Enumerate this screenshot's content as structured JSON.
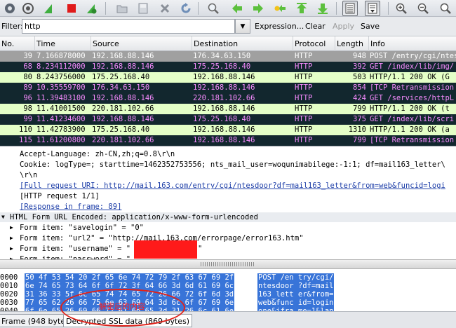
{
  "toolbar": {
    "icons": [
      "stop-capture-icon",
      "capture-options-icon",
      "shark-fin-icon",
      "stop-icon",
      "red-reload-icon",
      "open-icon",
      "save-icon",
      "close-icon",
      "reload-icon",
      "find-icon",
      "back-icon",
      "forward-icon",
      "go-to-icon",
      "first-icon",
      "last-icon",
      "colorize-icon",
      "autoscroll-icon",
      "zoom-in-icon",
      "zoom-out-icon",
      "zoom-reset-icon"
    ]
  },
  "filter": {
    "label": "Filter:",
    "value": "http",
    "expression": "Expression...",
    "clear": "Clear",
    "apply": "Apply",
    "save": "Save"
  },
  "packet_list": {
    "columns": [
      "No.",
      "Time",
      "Source",
      "Destination",
      "Protocol",
      "Length",
      "Info"
    ],
    "rows": [
      {
        "no": "39",
        "time": "7.166878000",
        "src": "192.168.88.146",
        "dst": "176.34.63.150",
        "proto": "HTTP",
        "len": "948",
        "info": "POST /entry/cgi/ntes",
        "bg": "#a0a0a0",
        "fg": "#ffffff"
      },
      {
        "no": "68",
        "time": "8.234112000",
        "src": "192.168.88.146",
        "dst": "175.25.168.40",
        "proto": "HTTP",
        "len": "392",
        "info": "GET /index/lib/img/",
        "bg": "#12272e",
        "fg": "#f78bff"
      },
      {
        "no": "80",
        "time": "8.243756000",
        "src": "175.25.168.40",
        "dst": "192.168.88.146",
        "proto": "HTTP",
        "len": "503",
        "info": "HTTP/1.1 200 OK  (G",
        "bg": "#e4ffc7",
        "fg": "#000000"
      },
      {
        "no": "89",
        "time": "10.35559700",
        "src": "176.34.63.150",
        "dst": "192.168.88.146",
        "proto": "HTTP",
        "len": "854",
        "info": "[TCP Retransmission",
        "bg": "#12272e",
        "fg": "#f78bff"
      },
      {
        "no": "96",
        "time": "11.39483100",
        "src": "192.168.88.146",
        "dst": "220.181.102.66",
        "proto": "HTTP",
        "len": "424",
        "info": "GET /services/httpL",
        "bg": "#12272e",
        "fg": "#f78bff"
      },
      {
        "no": "98",
        "time": "11.41001500",
        "src": "220.181.102.66",
        "dst": "192.168.88.146",
        "proto": "HTTP",
        "len": "799",
        "info": "HTTP/1.1 200 OK  (t",
        "bg": "#e4ffc7",
        "fg": "#000000"
      },
      {
        "no": "99",
        "time": "11.41234600",
        "src": "192.168.88.146",
        "dst": "175.25.168.40",
        "proto": "HTTP",
        "len": "375",
        "info": "GET /index/lib/scri",
        "bg": "#12272e",
        "fg": "#f78bff"
      },
      {
        "no": "110",
        "time": "11.42783900",
        "src": "175.25.168.40",
        "dst": "192.168.88.146",
        "proto": "HTTP",
        "len": "1310",
        "info": "HTTP/1.1 200 OK  (a",
        "bg": "#e4ffc7",
        "fg": "#000000"
      },
      {
        "no": "115",
        "time": "11.61200800",
        "src": "220.181.102.66",
        "dst": "192.168.88.146",
        "proto": "HTTP",
        "len": "799",
        "info": "[TCP Retransmission",
        "bg": "#12272e",
        "fg": "#f78bff"
      }
    ]
  },
  "details": {
    "lines": [
      {
        "text": "Accept-Language: zh-CN,zh;q=0.8\\r\\n",
        "type": "plain"
      },
      {
        "text": "Cookie: logType=; starttime=1462352753556; nts_mail_user=woqunimabilege:-1:1; df=mail163_letter\\",
        "type": "plain"
      },
      {
        "text": "\\r\\n",
        "type": "plain"
      },
      {
        "text": "[Full request URI: http://mail.163.com/entry/cgi/ntesdoor?df=mail163_letter&from=web&funcid=logi",
        "type": "link"
      },
      {
        "text": "[HTTP request 1/1]",
        "type": "plain"
      },
      {
        "text": "[Response in frame: 89]",
        "type": "link"
      },
      {
        "text": "HTML Form URL Encoded: application/x-www-form-urlencoded",
        "type": "section"
      },
      {
        "text": "Form item: \"savelogin\" = \"0\"",
        "type": "item"
      },
      {
        "text": "Form item: \"url2\" = \"http://mail.163.com/errorpage/error163.htm\"",
        "type": "item"
      },
      {
        "text": "Form item: \"username\" = \"",
        "type": "item",
        "suffix": "\""
      },
      {
        "text": "Form item: \"password\" = \"",
        "type": "item"
      }
    ]
  },
  "hex": {
    "rows": [
      {
        "offset": "0000",
        "bytes": "50 4f 53 54 20 2f 65 6e  74 72 79 2f 63 67 69 2f",
        "ascii": "POST /en try/cgi/"
      },
      {
        "offset": "0010",
        "bytes": "6e 74 65 73 64 6f 6f 72  3f 64 66 3d 6d 61 69 6c",
        "ascii": "ntesdoor ?df=mail"
      },
      {
        "offset": "0020",
        "bytes": "31 36 33 5f 6c 65 74 74  65 72 26 66 72 6f 6d 3d",
        "ascii": "163_lett er&from="
      },
      {
        "offset": "0030",
        "bytes": "77 65 62 26 66 75 6e 63  69 64 3d 6c 6f 67 69 6e",
        "ascii": "web&func id=login"
      },
      {
        "offset": "0040",
        "bytes": "6f 6e 65 26 69 66 72 61  6d 65 3d 31 26 6c 61 6e",
        "ascii": "one&ifra me=1&lan"
      }
    ]
  },
  "tabs": {
    "frame": "Frame (948 bytes)",
    "decrypted": "Decrypted SSL data (869 bytes)"
  },
  "annotation": {
    "text": "解密后的内容",
    "color": "#e0221a"
  }
}
